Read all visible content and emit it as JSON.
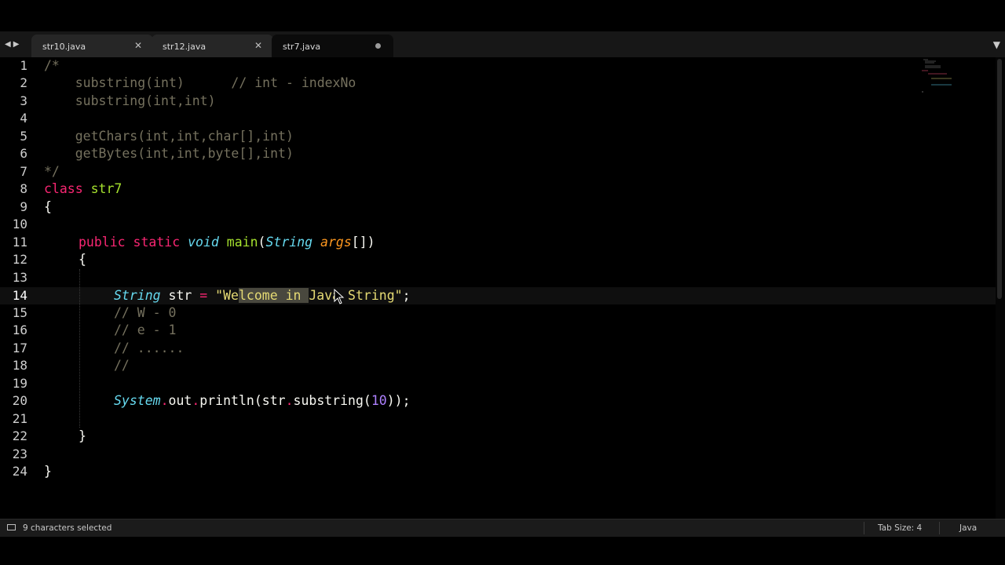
{
  "tabs": [
    {
      "name": "str10.java",
      "state": "close"
    },
    {
      "name": "str12.java",
      "state": "close"
    },
    {
      "name": "str7.java",
      "state": "modified"
    }
  ],
  "line_numbers": [
    "1",
    "2",
    "3",
    "4",
    "5",
    "6",
    "7",
    "8",
    "9",
    "10",
    "11",
    "12",
    "13",
    "14",
    "15",
    "16",
    "17",
    "18",
    "19",
    "20",
    "21",
    "22",
    "23",
    "24"
  ],
  "current_line": 14,
  "code": {
    "l1": "/*",
    "l2a": "    substring(int)      ",
    "l2b": "// int - indexNo",
    "l3": "    substring(int,int)",
    "l5": "    getChars(int,int,char[],int)",
    "l6": "    getBytes(int,int,byte[],int)",
    "l7": "*/",
    "l8_kw": "class",
    "l8_name": "str7",
    "l9": "{",
    "l11_public": "public",
    "l11_static": "static",
    "l11_void": "void",
    "l11_main": "main",
    "l11_paren": "(",
    "l11_type": "String",
    "l11_arg": "args",
    "l11_end": "[])",
    "l12": "{",
    "l14_type": "String",
    "l14_var": " str ",
    "l14_eq": "=",
    "l14_q1": "\"We",
    "l14_sel": "lcome in ",
    "l14_rest": "Java String\"",
    "l14_semi": ";",
    "l15": "// W - 0",
    "l16": "// e - 1",
    "l17": "// ......",
    "l18": "//",
    "l20_sys": "System",
    "l20_dot1": ".",
    "l20_out": "out",
    "l20_dot2": ".",
    "l20_call": "println(str",
    "l20_dot3": ".",
    "l20_sub": "substring(",
    "l20_num": "10",
    "l20_end": "));",
    "l22": "}",
    "l24": "}"
  },
  "status": {
    "selection": "9 characters selected",
    "tab_size": "Tab Size: 4",
    "syntax": "Java"
  },
  "colors": {
    "keyword": "#f92672",
    "class_name": "#a6e22e",
    "type": "#66d9ef",
    "argument": "#fd971f",
    "string": "#e6db74",
    "number": "#ae81ff",
    "comment": "#75715e",
    "selection": "#49483e"
  }
}
